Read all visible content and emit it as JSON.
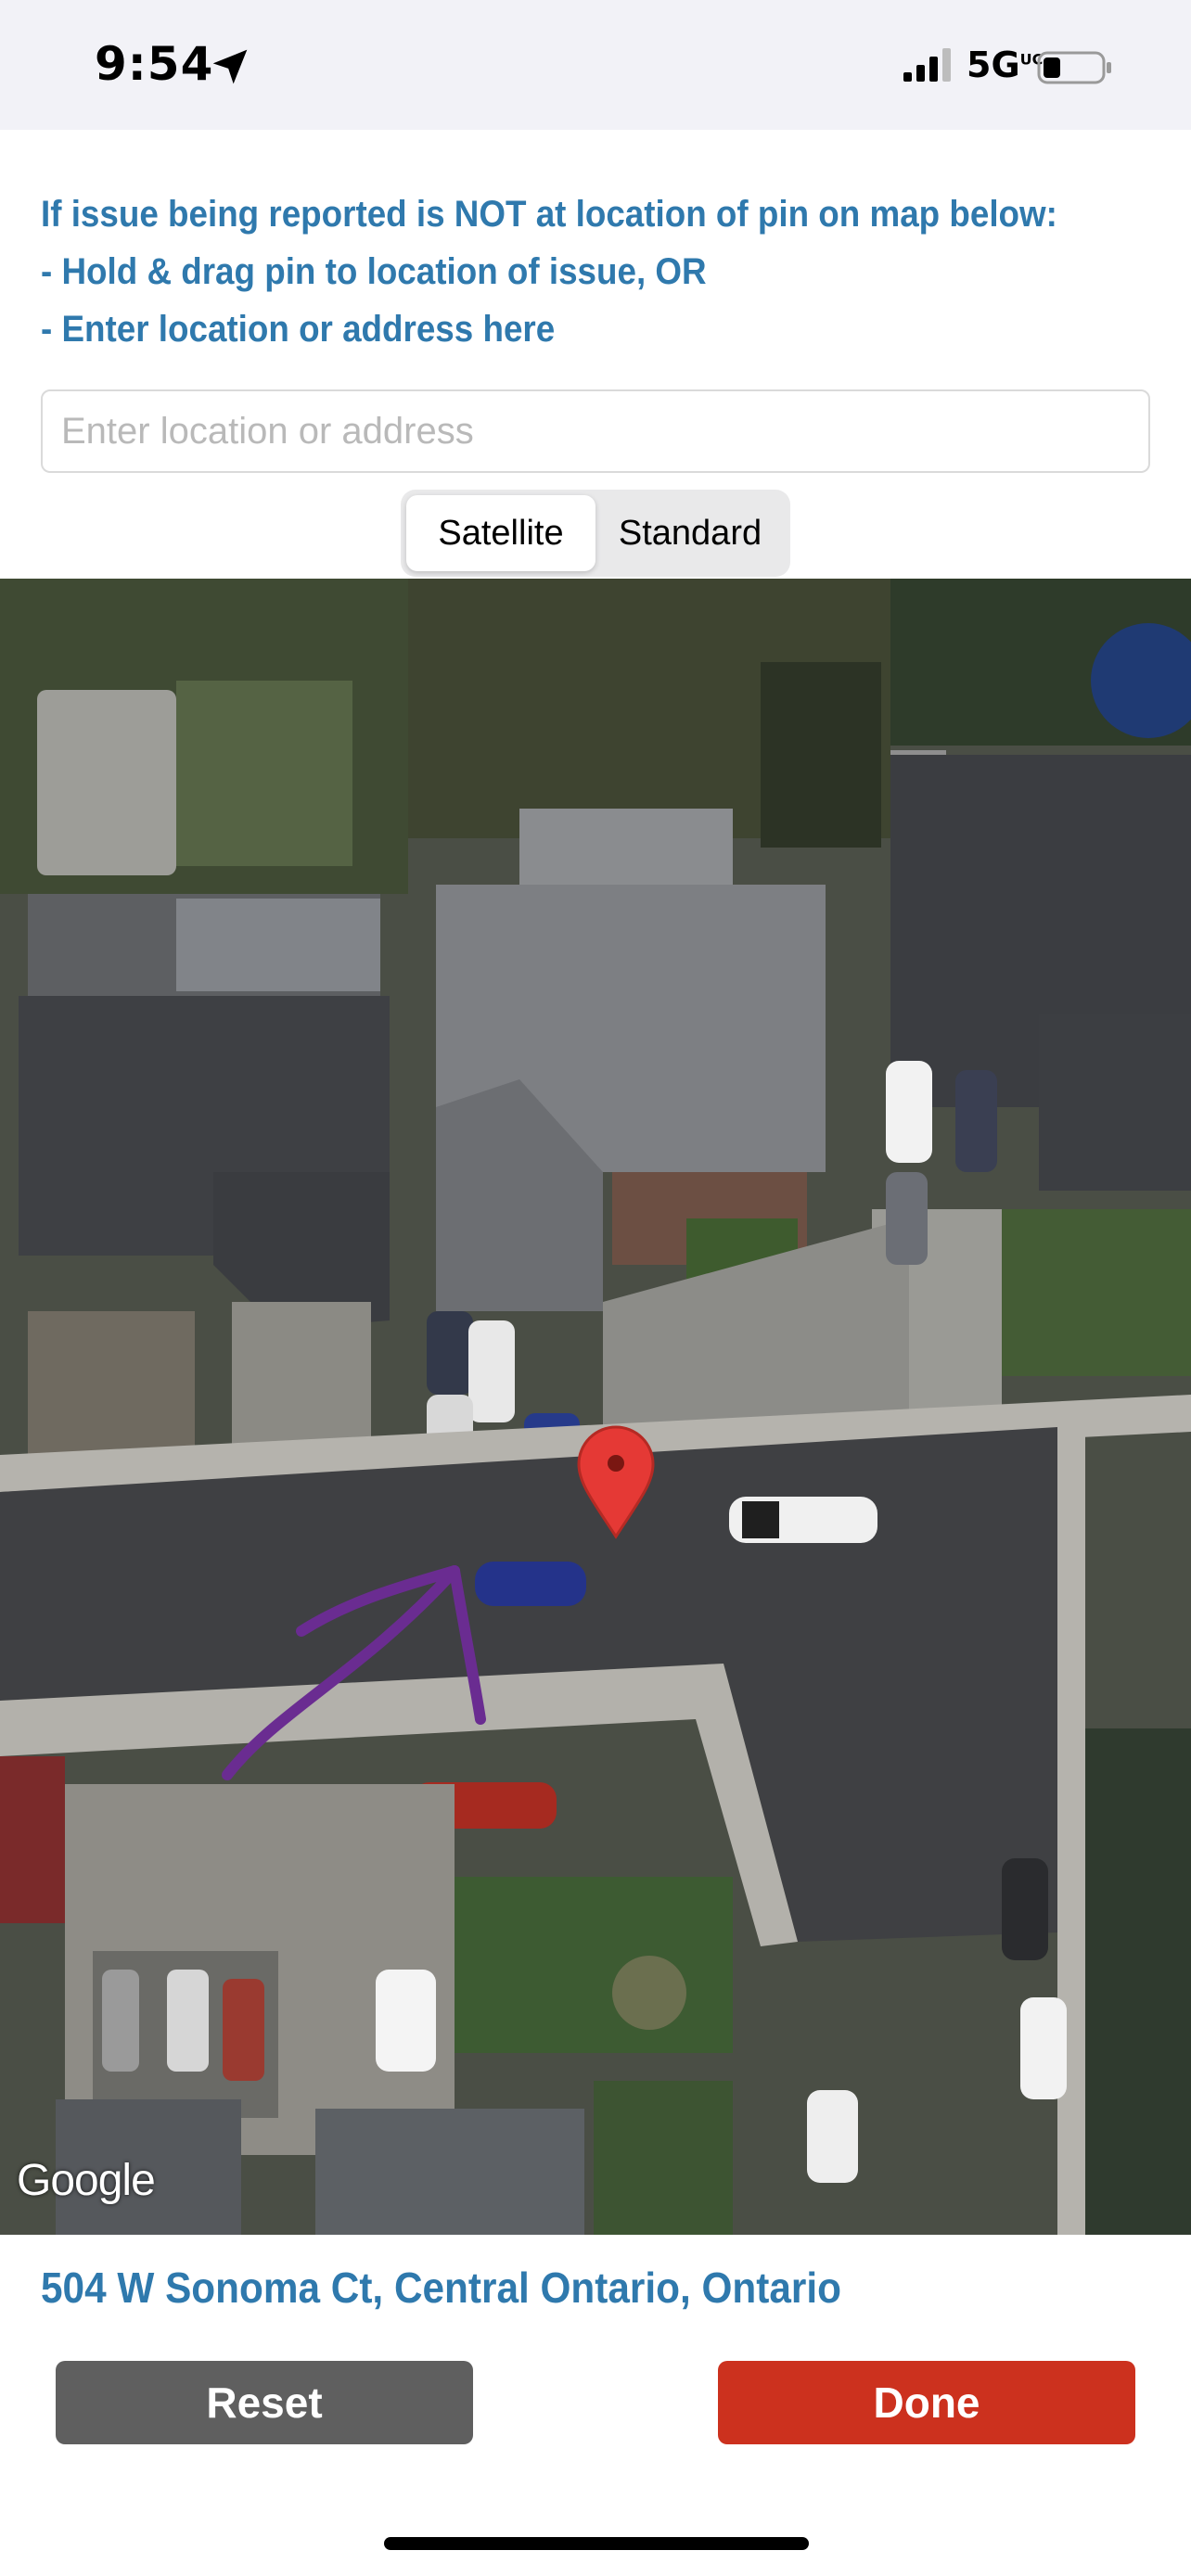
{
  "status_bar": {
    "time": "9:54",
    "network": "5G",
    "network_suffix": "UC",
    "icons": [
      "location-arrow-icon",
      "cellular-signal-icon",
      "battery-icon"
    ]
  },
  "instructions": {
    "line1": "If issue being reported is NOT at location of pin on map below:",
    "line2": "- Hold & drag pin to location of issue, OR",
    "line3": "- Enter location or address here"
  },
  "search": {
    "placeholder": "Enter location or address",
    "value": ""
  },
  "map_type": {
    "options": [
      "Satellite",
      "Standard"
    ],
    "selected": "Satellite"
  },
  "map": {
    "attribution": "Google",
    "pin_color": "#e53935",
    "annotation_color": "#6a2c91"
  },
  "address": "504 W Sonoma Ct, Central Ontario, Ontario",
  "buttons": {
    "reset": "Reset",
    "done": "Done"
  },
  "colors": {
    "accent_text": "#2f79ad",
    "reset_button": "#5f5f5f",
    "done_button": "#cc311e"
  }
}
